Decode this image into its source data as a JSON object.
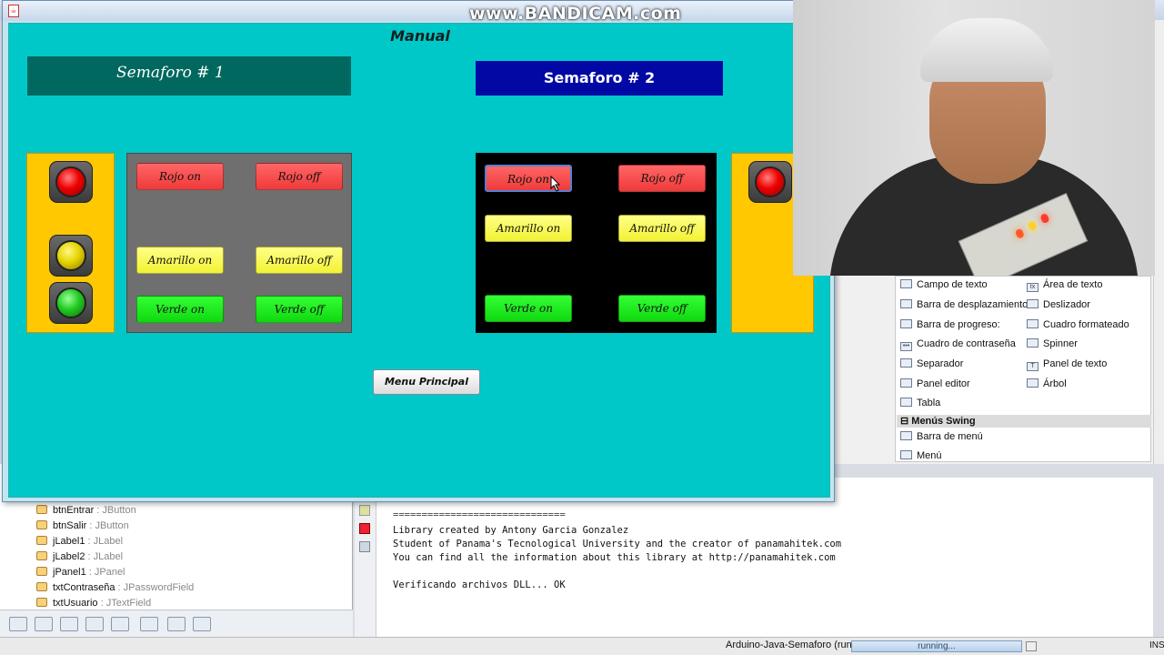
{
  "watermark": "www.BANDICAM.com",
  "window": {
    "title": "Manual",
    "semaforo1_label": "Semaforo # 1",
    "semaforo2_label": "Semaforo # 2",
    "panel1": {
      "rojo_on": "Rojo on",
      "rojo_off": "Rojo off",
      "amarillo_on": "Amarillo on",
      "amarillo_off": "Amarillo off",
      "verde_on": "Verde on",
      "verde_off": "Verde off"
    },
    "panel2": {
      "rojo_on": "Rojo on",
      "rojo_off": "Rojo off",
      "amarillo_on": "Amarillo on",
      "amarillo_off": "Amarillo off",
      "verde_on": "Verde on",
      "verde_off": "Verde off"
    },
    "menu_principal": "Menu Principal",
    "colors": {
      "background": "#00c8c8",
      "sem1_label_bg": "#00685f",
      "sem2_label_bg": "#0208a4",
      "light_box": "#ffc800",
      "red": "#f03a3a",
      "yellow": "#f2f233",
      "green": "#10d810"
    }
  },
  "palette": {
    "items_left": [
      "Campo de texto",
      "Barra de desplazamiento",
      "Barra de progreso:",
      "Cuadro de contraseña",
      "Separador",
      "Panel editor",
      "Tabla"
    ],
    "items_right": [
      "Área de texto",
      "Deslizador",
      "Cuadro formateado",
      "Spinner",
      "Panel de texto",
      "Árbol"
    ],
    "section": "Menús Swing",
    "menu_items": [
      "Barra de menú",
      "Menú"
    ]
  },
  "navigator": [
    {
      "name": "btnEntrar",
      "type": " : JButton"
    },
    {
      "name": "btnSalir",
      "type": " : JButton"
    },
    {
      "name": "jLabel1",
      "type": " : JLabel"
    },
    {
      "name": "jLabel2",
      "type": " : JLabel"
    },
    {
      "name": "jPanel1",
      "type": " : JPanel"
    },
    {
      "name": "txtContraseña",
      "type": " : JPasswordField"
    },
    {
      "name": "txtUsuario",
      "type": " : JTextField"
    }
  ],
  "output": {
    "lines": [
      "==============================",
      "Library created by Antony Garcia Gonzalez",
      "Student of Panama's Tecnological University and the creator of panamahitek.com",
      "You can find all the information about this library at http://panamahitek.com",
      "",
      "Verificando archivos DLL... OK"
    ]
  },
  "status": {
    "project": "Arduino-Java-Semaforo (run)",
    "progress_text": "running...",
    "mode": "INS"
  }
}
